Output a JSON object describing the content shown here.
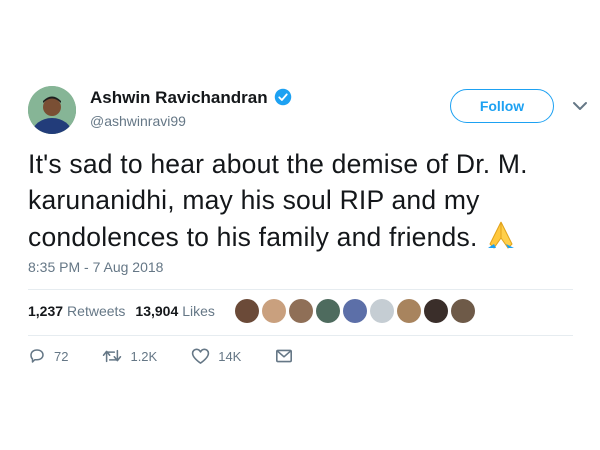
{
  "author": {
    "name": "Ashwin Ravichandran",
    "handle": "@ashwinravi99"
  },
  "follow_label": "Follow",
  "tweet": {
    "line1": "It's sad to hear about the demise of Dr. M.",
    "line2": "karunanidhi, may his soul RIP and my",
    "line3": "condolences to his family and friends.",
    "emoji": "folded-hands-icon"
  },
  "timestamp": "8:35 PM - 7 Aug 2018",
  "stats": {
    "retweets_count": "1,237",
    "retweets_label": "Retweets",
    "likes_count": "13,904",
    "likes_label": "Likes"
  },
  "actions": {
    "replies": "72",
    "retweets": "1.2K",
    "likes": "14K"
  },
  "colors": {
    "accent": "#1da1f2",
    "verified": "#1da1f2",
    "muted": "#657786",
    "text": "#14171a"
  },
  "liker_avatars": [
    "avatar-1",
    "avatar-2",
    "avatar-3",
    "avatar-4",
    "avatar-5",
    "avatar-6",
    "avatar-7",
    "avatar-8",
    "avatar-9"
  ]
}
